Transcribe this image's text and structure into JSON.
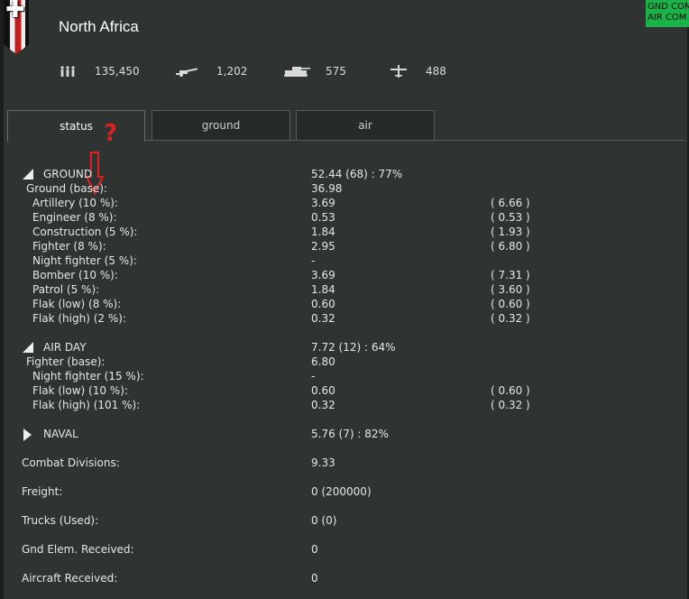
{
  "header": {
    "title": "North Africa",
    "corner_badge_lines": [
      "GND COM",
      "AIR COM"
    ]
  },
  "stats": [
    {
      "icon": "infantry-icon",
      "value": "135,450"
    },
    {
      "icon": "gun-icon",
      "value": "1,202"
    },
    {
      "icon": "tank-icon",
      "value": "575"
    },
    {
      "icon": "aircraft-icon",
      "value": "488"
    }
  ],
  "tabs": [
    {
      "label": "status",
      "active": true
    },
    {
      "label": "ground",
      "active": false
    },
    {
      "label": "air",
      "active": false
    }
  ],
  "annotation": {
    "question_mark": "?"
  },
  "ground": {
    "header": {
      "label": "GROUND",
      "value": "52.44  (68)  :  77%"
    },
    "base": {
      "label": "Ground (base):",
      "value": "36.98"
    },
    "rows": [
      {
        "label": "Artillery (10 %):",
        "value": "3.69",
        "extra": "( 6.66 )"
      },
      {
        "label": "Engineer (8 %):",
        "value": "0.53",
        "extra": "( 0.53 )"
      },
      {
        "label": "Construction (5 %):",
        "value": "1.84",
        "extra": "( 1.93 )"
      },
      {
        "label": "Fighter (8 %):",
        "value": "2.95",
        "extra": "( 6.80 )"
      },
      {
        "label": "Night fighter (5 %):",
        "value": "-",
        "extra": ""
      },
      {
        "label": "Bomber (10 %):",
        "value": "3.69",
        "extra": "( 7.31 )"
      },
      {
        "label": "Patrol (5 %):",
        "value": "1.84",
        "extra": "( 3.60 )"
      },
      {
        "label": "Flak (low) (8 %):",
        "value": "0.60",
        "extra": "( 0.60 )"
      },
      {
        "label": "Flak (high) (2 %):",
        "value": "0.32",
        "extra": "( 0.32 )"
      }
    ]
  },
  "air_day": {
    "header": {
      "label": "AIR DAY",
      "value": "7.72  (12)  :  64%"
    },
    "base": {
      "label": "Fighter (base):",
      "value": "6.80"
    },
    "rows": [
      {
        "label": "Night fighter (15 %):",
        "value": "-",
        "extra": ""
      },
      {
        "label": "Flak (low) (10 %):",
        "value": "0.60",
        "extra": "( 0.60 )"
      },
      {
        "label": "Flak (high) (101 %):",
        "value": "0.32",
        "extra": "( 0.32 )"
      }
    ]
  },
  "naval": {
    "label": "NAVAL",
    "value": "5.76  (7)  :  82%"
  },
  "summary": [
    {
      "label": "Combat Divisions:",
      "value": "9.33"
    },
    {
      "label": "Freight:",
      "value": "0 (200000)"
    },
    {
      "label": "Trucks (Used):",
      "value": "0 (0)"
    },
    {
      "label": "Gnd Elem. Received:",
      "value": "0"
    },
    {
      "label": "Aircraft Received:",
      "value": "0"
    }
  ]
}
